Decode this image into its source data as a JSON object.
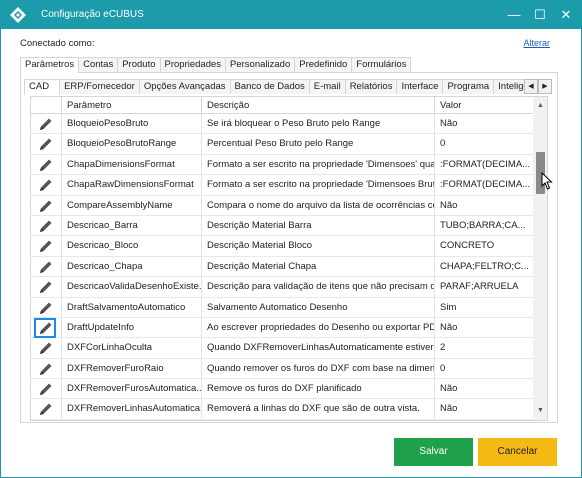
{
  "window": {
    "title": "Configuração eCUBUS",
    "minimize_glyph": "—",
    "maximize_glyph": "☐",
    "close_glyph": "✕"
  },
  "header": {
    "connected_label": "Conectado como:",
    "alter_link": "Alterar"
  },
  "top_tabs": [
    "Parâmetros",
    "Contas",
    "Produto",
    "Propriedades",
    "Personalizado",
    "Predefinido",
    "Formulários"
  ],
  "top_tab_active": 0,
  "sub_tabs": [
    "CAD",
    "ERP/Fornecedor",
    "Opções Avançadas",
    "Banco de Dados",
    "E-mail",
    "Relatórios",
    "Interface",
    "Programa",
    "Inteligên"
  ],
  "sub_tab_active": 0,
  "sub_tab_scroll": {
    "left": "◀",
    "right": "▶"
  },
  "grid": {
    "columns": [
      "Parâmetro",
      "Descrição",
      "Valor"
    ],
    "rows": [
      {
        "param": "BloqueioPesoBruto",
        "desc": "Se irá bloquear o Peso Bruto pelo Range",
        "value": "Não"
      },
      {
        "param": "BloqueioPesoBrutoRange",
        "desc": "Percentual Peso Bruto pelo Range",
        "value": "0"
      },
      {
        "param": "ChapaDimensionsFormat",
        "desc": "Formato a ser escrito na propriedade 'Dimensoes' quan...",
        "value": ":FORMAT(DECIMA..."
      },
      {
        "param": "ChapaRawDimensionsFormat",
        "desc": "Formato a ser escrito na propriedade 'Dimensoes Bruta...",
        "value": ":FORMAT(DECIMA..."
      },
      {
        "param": "CompareAssemblyName",
        "desc": "Compara o nome do arquivo da lista de ocorrências co...",
        "value": "Não"
      },
      {
        "param": "Descricao_Barra",
        "desc": "Descrição Material Barra",
        "value": "TUBO;BARRA;CA..."
      },
      {
        "param": "Descricao_Bloco",
        "desc": "Descrição Material Bloco",
        "value": "CONCRETO"
      },
      {
        "param": "Descricao_Chapa",
        "desc": "Descrição Material Chapa",
        "value": "CHAPA;FELTRO;C..."
      },
      {
        "param": "DescricaoValidaDesenhoExiste...",
        "desc": "Descrição para validação de itens que não precisam d...",
        "value": "PARAF;ARRUELA"
      },
      {
        "param": "DraftSalvamentoAutomatico",
        "desc": "Salvamento Automatico Desenho",
        "value": "Sim"
      },
      {
        "param": "DraftUpdateInfo",
        "desc": "Ao escrever propriedades do Desenho ou exportar PD...",
        "value": "Não"
      },
      {
        "param": "DXFCorLinhaOculta",
        "desc": "Quando DXFRemoverLinhasAutomaticamente estiver ...",
        "value": "2"
      },
      {
        "param": "DXFRemoverFuroRaio",
        "desc": "Quando remover os furos do DXF com base na dimens...",
        "value": "0"
      },
      {
        "param": "DXFRemoverFurosAutomatica...",
        "desc": "Remove os furos do DXF planificado",
        "value": "Não"
      },
      {
        "param": "DXFRemoverLinhasAutomatica...",
        "desc": "Removerá a linhas do DXF que são de outra vista.",
        "value": "Não"
      }
    ],
    "selected_row": 10,
    "edit_icon": "pencil-icon",
    "scroll_up": "▲",
    "scroll_down": "▼"
  },
  "footer": {
    "save_label": "Salvar",
    "cancel_label": "Cancelar"
  },
  "colors": {
    "titlebar": "#1c9caa",
    "save": "#1fa04a",
    "cancel": "#f5b914",
    "selection": "#1d8ce0"
  }
}
